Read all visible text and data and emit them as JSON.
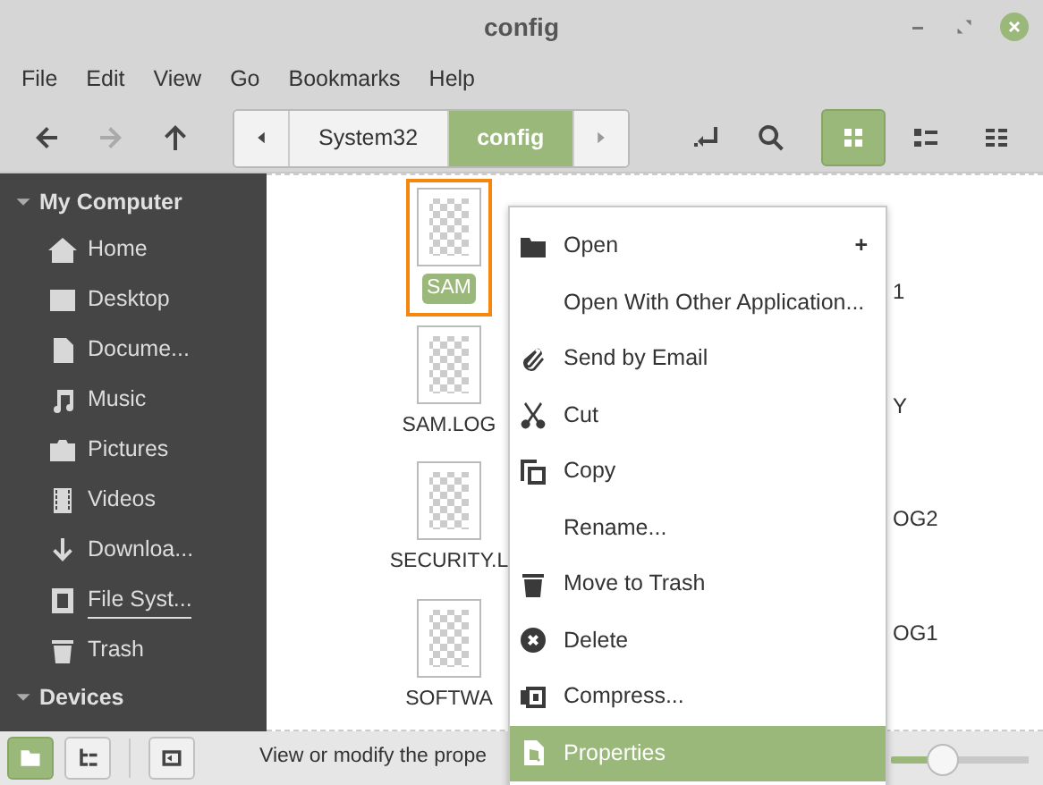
{
  "window": {
    "title": "config"
  },
  "menubar": [
    "File",
    "Edit",
    "View",
    "Go",
    "Bookmarks",
    "Help"
  ],
  "toolbar": {
    "nav": [
      {
        "kind": "back",
        "disabled": false
      },
      {
        "kind": "forward",
        "disabled": true
      },
      {
        "kind": "up",
        "disabled": false
      }
    ],
    "path": [
      {
        "label": "System32",
        "selected": false
      },
      {
        "label": "config",
        "selected": true
      }
    ],
    "views": [
      {
        "kind": "icons",
        "selected": true
      },
      {
        "kind": "list",
        "selected": false
      },
      {
        "kind": "compact",
        "selected": false
      }
    ]
  },
  "sidebar": {
    "sections": [
      {
        "title": "My Computer",
        "expanded": true,
        "items": [
          {
            "label": "Home",
            "kind": "home",
            "selected": false
          },
          {
            "label": "Desktop",
            "kind": "desktop",
            "selected": false
          },
          {
            "label": "Docume...",
            "kind": "document",
            "selected": false
          },
          {
            "label": "Music",
            "kind": "music",
            "selected": false
          },
          {
            "label": "Pictures",
            "kind": "camera",
            "selected": false
          },
          {
            "label": "Videos",
            "kind": "film",
            "selected": false
          },
          {
            "label": "Downloa...",
            "kind": "download",
            "selected": false
          },
          {
            "label": "File Syst...",
            "kind": "drive",
            "selected": true
          },
          {
            "label": "Trash",
            "kind": "trash",
            "selected": false
          }
        ]
      },
      {
        "title": "Devices",
        "expanded": true
      }
    ]
  },
  "files": [
    {
      "label": "SAM",
      "selected": true,
      "outlined": true
    },
    {
      "label": "SAM.LOG",
      "selected": false,
      "outlined": false
    },
    {
      "label": "SECURITY.L",
      "selected": false,
      "outlined": false
    },
    {
      "label": "SOFTWA",
      "selected": false,
      "outlined": false
    }
  ],
  "files_column_2": [
    "1",
    "Y",
    "OG2",
    "OG1"
  ],
  "context_menu": [
    {
      "label": "Open",
      "kind": "folder",
      "accessory": "+",
      "selected": false
    },
    {
      "label": "Open With Other Application...",
      "kind": "none",
      "selected": false
    },
    {
      "label": "Send by Email",
      "kind": "clip",
      "selected": false
    },
    {
      "label": "Cut",
      "kind": "scissors",
      "selected": false
    },
    {
      "label": "Copy",
      "kind": "copy",
      "selected": false
    },
    {
      "label": "Rename...",
      "kind": "none",
      "selected": false
    },
    {
      "label": "Move to Trash",
      "kind": "trash",
      "selected": false
    },
    {
      "label": "Delete",
      "kind": "delete",
      "selected": false
    },
    {
      "label": "Compress...",
      "kind": "compress",
      "selected": false
    },
    {
      "label": "Properties",
      "kind": "properties",
      "selected": true
    }
  ],
  "status_bar": {
    "buttons": [
      {
        "kind": "places",
        "selected": true
      },
      {
        "kind": "tree",
        "selected": false
      },
      {
        "kind": "sidebar",
        "selected": false
      }
    ],
    "text": "View or modify the prope",
    "zoom": {
      "level": 0.38
    }
  }
}
